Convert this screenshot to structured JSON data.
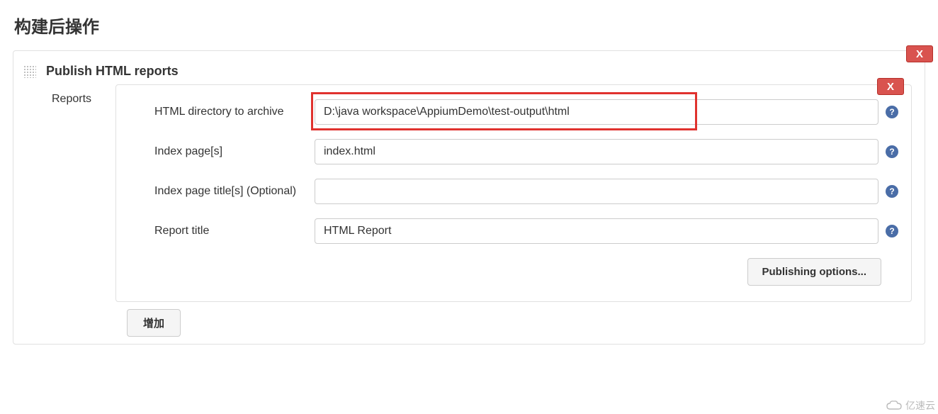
{
  "section": {
    "title": "构建后操作"
  },
  "publisher": {
    "title": "Publish HTML reports",
    "reports_label": "Reports",
    "delete_label": "X",
    "inner_delete_label": "X",
    "fields": {
      "html_dir": {
        "label": "HTML directory to archive",
        "value": "D:\\java workspace\\AppiumDemo\\test-output\\html"
      },
      "index_page": {
        "label": "Index page[s]",
        "value": "index.html"
      },
      "index_title": {
        "label": "Index page title[s] (Optional)",
        "value": ""
      },
      "report_title": {
        "label": "Report title",
        "value": "HTML Report"
      }
    },
    "publishing_options": "Publishing options...",
    "add_button": "增加",
    "help_glyph": "?"
  },
  "watermark": {
    "text": "亿速云"
  }
}
